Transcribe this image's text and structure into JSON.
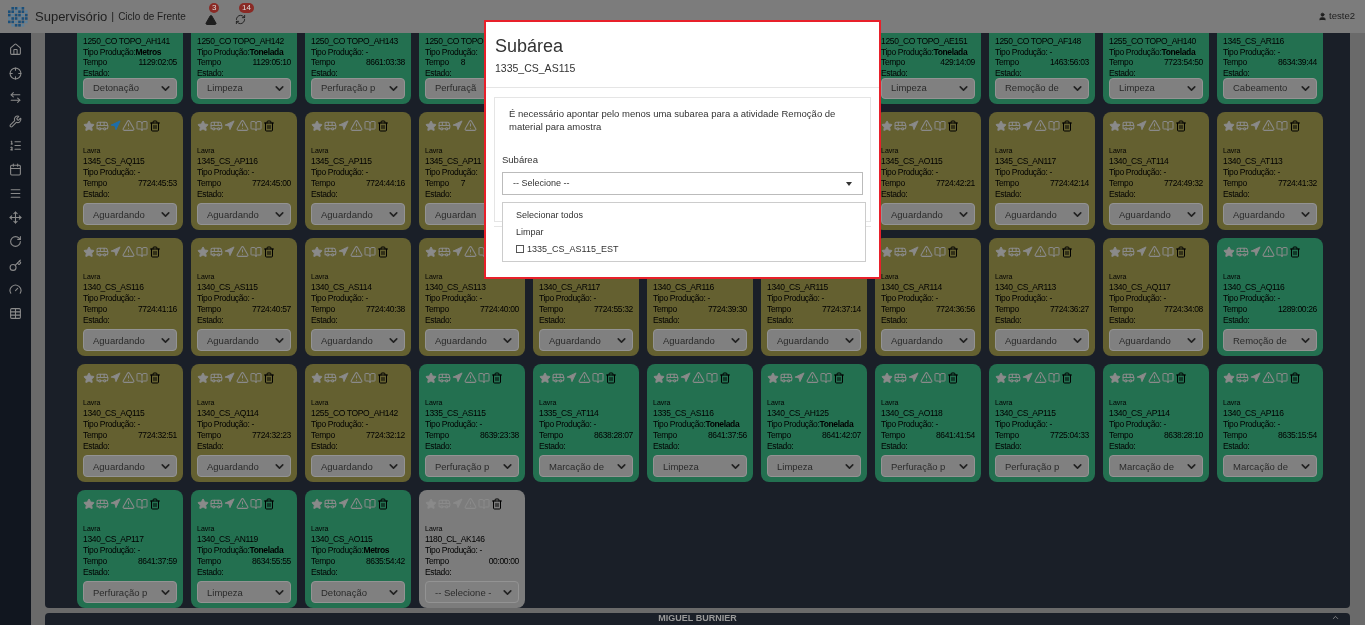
{
  "header": {
    "app": "Supervisório",
    "separator": "|",
    "module": "Ciclo de Frente",
    "alerts": [
      {
        "kind": "warning",
        "count": "3"
      },
      {
        "kind": "refresh",
        "count": "14"
      }
    ],
    "user": "teste2"
  },
  "rows": [
    [
      {
        "kind": "scrolled",
        "name": "1250_CO TOPO_AH141",
        "production": "Tipo Produção:**Metros**",
        "time_label": "Tempo",
        "time": "1129:02:05",
        "state_label": "Estado:",
        "state": "Detonação",
        "color": "#237050"
      },
      {
        "kind": "scrolled",
        "name": "1250_CO TOPO_AH142",
        "production": "Tipo Produção:**Tonelada**",
        "time_label": "Tempo",
        "time": "1129:05:10",
        "state_label": "Estado:",
        "state": "Limpeza",
        "color": "#237050"
      },
      {
        "kind": "scrolled",
        "name": "1250_CO TOPO_AH143",
        "production": "Tipo Produção: -",
        "time_label": "Tempo",
        "time": "8661:03:38",
        "state_label": "Estado:",
        "state": "Perfuração p",
        "color": "#237050"
      },
      {
        "kind": "scrolled_clipped",
        "name": "1250_CO TOPO",
        "production": "Tipo Produção:",
        "time_label": "Tempo",
        "time": "8",
        "state_label": "Estado:",
        "state": "Perfuraçã",
        "color": "#237050"
      },
      null,
      null,
      null,
      {
        "kind": "scrolled",
        "name": "1250_CO TOPO_AE151",
        "production": "Tipo Produção:**Tonelada**",
        "time_label": "Tempo",
        "time": "429:14:09",
        "state_label": "Estado:",
        "state": "Limpeza",
        "color": "#237050"
      },
      {
        "kind": "scrolled",
        "name": "1250_CO TOPO_AF148",
        "production": "Tipo Produção: -",
        "time_label": "Tempo",
        "time": "1463:56:03",
        "state_label": "Estado:",
        "state": "Remoção de",
        "color": "#237050"
      },
      {
        "kind": "scrolled",
        "name": "1255_CO TOPO_AH140",
        "production": "Tipo Produção:**Tonelada**",
        "time_label": "Tempo",
        "time": "7723:54:50",
        "state_label": "Estado:",
        "state": "Limpeza",
        "color": "#237050"
      },
      {
        "kind": "scrolled",
        "name": "1345_CS_AR116",
        "production": "Tipo Produção: -",
        "time_label": "Tempo",
        "time": "8634:39:44",
        "state_label": "Estado:",
        "state": "Cabeamento",
        "color": "#237050"
      }
    ],
    [
      {
        "kind": "full",
        "area": "Lavra",
        "name": "1345_CS_AQ115",
        "production": "Tipo Produção: -",
        "time_label": "Tempo",
        "time": "7724:45:53",
        "state_label": "Estado:",
        "state": "Aguardando",
        "color": "#646030",
        "located": true
      },
      {
        "kind": "full",
        "area": "Lavra",
        "name": "1345_CS_AP116",
        "production": "Tipo Produção: -",
        "time_label": "Tempo",
        "time": "7724:45:00",
        "state_label": "Estado:",
        "state": "Aguardando",
        "color": "#646030",
        "located": false
      },
      {
        "kind": "full",
        "area": "Lavra",
        "name": "1345_CS_AP115",
        "production": "Tipo Produção: -",
        "time_label": "Tempo",
        "time": "7724:44:16",
        "state_label": "Estado:",
        "state": "Aguardando",
        "color": "#646030",
        "located": false
      },
      {
        "kind": "clipped",
        "area": "Lavra",
        "name": "1345_CS_AP11",
        "production": "Tipo Produção:",
        "time_label": "Tempo",
        "time": "7",
        "state_label": "Estado:",
        "state": "Aguardan",
        "color": "#646030",
        "located": false
      },
      null,
      null,
      null,
      {
        "kind": "full",
        "area": "Lavra",
        "name": "1345_CS_AO115",
        "production": "Tipo Produção: -",
        "time_label": "Tempo",
        "time": "7724:42:21",
        "state_label": "Estado:",
        "state": "Aguardando",
        "color": "#646030",
        "located": false
      },
      {
        "kind": "full",
        "area": "Lavra",
        "name": "1345_CS_AN117",
        "production": "Tipo Produção: -",
        "time_label": "Tempo",
        "time": "7724:42:14",
        "state_label": "Estado:",
        "state": "Aguardando",
        "color": "#646030",
        "located": false
      },
      {
        "kind": "full",
        "area": "Lavra",
        "name": "1340_CS_AT114",
        "production": "Tipo Produção: -",
        "time_label": "Tempo",
        "time": "7724:49:32",
        "state_label": "Estado:",
        "state": "Aguardando",
        "color": "#646030",
        "located": false
      },
      {
        "kind": "full",
        "area": "Lavra",
        "name": "1340_CS_AT113",
        "production": "Tipo Produção: -",
        "time_label": "Tempo",
        "time": "7724:41:32",
        "state_label": "Estado:",
        "state": "Aguardando",
        "color": "#646030",
        "located": false
      }
    ],
    [
      {
        "kind": "full",
        "area": "Lavra",
        "name": "1340_CS_AS116",
        "production": "Tipo Produção: -",
        "time_label": "Tempo",
        "time": "7724:41:16",
        "state_label": "Estado:",
        "state": "Aguardando",
        "color": "#646030",
        "located": false
      },
      {
        "kind": "full",
        "area": "Lavra",
        "name": "1340_CS_AS115",
        "production": "Tipo Produção: -",
        "time_label": "Tempo",
        "time": "7724:40:57",
        "state_label": "Estado:",
        "state": "Aguardando",
        "color": "#646030",
        "located": false
      },
      {
        "kind": "full",
        "area": "Lavra",
        "name": "1340_CS_AS114",
        "production": "Tipo Produção: -",
        "time_label": "Tempo",
        "time": "7724:40:38",
        "state_label": "Estado:",
        "state": "Aguardando",
        "color": "#646030",
        "located": false
      },
      {
        "kind": "icons_clipped",
        "area": "Lavra",
        "name": "1340_CS_AS113",
        "production": "Tipo Produção: -",
        "time_label": "Tempo",
        "time": "7724:40:00",
        "state_label": "Estado:",
        "state": "Aguardando",
        "color": "#646030",
        "located": false
      },
      {
        "kind": "covered",
        "name": "1340_CS_AR117",
        "production": "Tipo Produção: -",
        "time_label": "Tempo",
        "time": "7724:55:32",
        "state_label": "Estado:",
        "state": "Aguardando",
        "color": "#646030"
      },
      {
        "kind": "covered",
        "name": "1340_CS_AR116",
        "production": "Tipo Produção: -",
        "time_label": "Tempo",
        "time": "7724:39:30",
        "state_label": "Estado:",
        "state": "Aguardando",
        "color": "#646030"
      },
      {
        "kind": "covered",
        "name": "1340_CS_AR115",
        "production": "Tipo Produção: -",
        "time_label": "Tempo",
        "time": "7724:37:14",
        "state_label": "Estado:",
        "state": "Aguardando",
        "color": "#646030"
      },
      {
        "kind": "full",
        "area": "Lavra",
        "name": "1340_CS_AR114",
        "production": "Tipo Produção: -",
        "time_label": "Tempo",
        "time": "7724:36:56",
        "state_label": "Estado:",
        "state": "Aguardando",
        "color": "#646030",
        "located": false
      },
      {
        "kind": "full",
        "area": "Lavra",
        "name": "1340_CS_AR113",
        "production": "Tipo Produção: -",
        "time_label": "Tempo",
        "time": "7724:36:27",
        "state_label": "Estado:",
        "state": "Aguardando",
        "color": "#646030",
        "located": false
      },
      {
        "kind": "full",
        "area": "Lavra",
        "name": "1340_CS_AQ117",
        "production": "Tipo Produção: -",
        "time_label": "Tempo",
        "time": "7724:34:08",
        "state_label": "Estado:",
        "state": "Aguardando",
        "color": "#646030",
        "located": false
      },
      {
        "kind": "full",
        "area": "Lavra",
        "name": "1340_CS_AQ116",
        "production": "Tipo Produção: -",
        "time_label": "Tempo",
        "time": "1289:00:26",
        "state_label": "Estado:",
        "state": "Remoção de",
        "color": "#237050",
        "located": false
      }
    ],
    [
      {
        "kind": "full",
        "area": "Lavra",
        "name": "1340_CS_AQ115",
        "production": "Tipo Produção: -",
        "time_label": "Tempo",
        "time": "7724:32:51",
        "state_label": "Estado:",
        "state": "Aguardando",
        "color": "#646030",
        "located": false
      },
      {
        "kind": "full",
        "area": "Lavra",
        "name": "1340_CS_AQ114",
        "production": "Tipo Produção: -",
        "time_label": "Tempo",
        "time": "7724:32:23",
        "state_label": "Estado:",
        "state": "Aguardando",
        "color": "#646030",
        "located": false
      },
      {
        "kind": "full",
        "area": "Lavra",
        "name": "1255_CO TOPO_AH142",
        "production": "Tipo Produção: -",
        "time_label": "Tempo",
        "time": "7724:32:12",
        "state_label": "Estado:",
        "state": "Aguardando",
        "color": "#646030",
        "located": false
      },
      {
        "kind": "full",
        "area": "Lavra",
        "name": "1335_CS_AS115",
        "production": "Tipo Produção: -",
        "time_label": "Tempo",
        "time": "8639:23:38",
        "state_label": "Estado:",
        "state": "Perfuração p",
        "color": "#237050",
        "located": false
      },
      {
        "kind": "full",
        "area": "Lavra",
        "name": "1335_CS_AT114",
        "production": "Tipo Produção: -",
        "time_label": "Tempo",
        "time": "8638:28:07",
        "state_label": "Estado:",
        "state": "Marcação de",
        "color": "#237050",
        "located": false
      },
      {
        "kind": "full",
        "area": "Lavra",
        "name": "1335_CS_AS116",
        "production": "Tipo Produção:**Tonelada**",
        "time_label": "Tempo",
        "time": "8641:37:56",
        "state_label": "Estado:",
        "state": "Limpeza",
        "color": "#237050",
        "located": false
      },
      {
        "kind": "full",
        "area": "Lavra",
        "name": "1340_CS_AH125",
        "production": "Tipo Produção:**Tonelada**",
        "time_label": "Tempo",
        "time": "8641:42:07",
        "state_label": "Estado:",
        "state": "Limpeza",
        "color": "#237050",
        "located": false
      },
      {
        "kind": "full",
        "area": "Lavra",
        "name": "1340_CS_AO118",
        "production": "Tipo Produção: -",
        "time_label": "Tempo",
        "time": "8641:41:54",
        "state_label": "Estado:",
        "state": "Perfuração p",
        "color": "#237050",
        "located": false
      },
      {
        "kind": "full",
        "area": "Lavra",
        "name": "1340_CS_AP115",
        "production": "Tipo Produção: -",
        "time_label": "Tempo",
        "time": "7725:04:33",
        "state_label": "Estado:",
        "state": "Perfuração p",
        "color": "#237050",
        "located": false
      },
      {
        "kind": "full",
        "area": "Lavra",
        "name": "1340_CS_AP114",
        "production": "Tipo Produção: -",
        "time_label": "Tempo",
        "time": "8638:28:10",
        "state_label": "Estado:",
        "state": "Marcação de",
        "color": "#237050",
        "located": false
      },
      {
        "kind": "full",
        "area": "Lavra",
        "name": "1340_CS_AP116",
        "production": "Tipo Produção: -",
        "time_label": "Tempo",
        "time": "8635:15:54",
        "state_label": "Estado:",
        "state": "Marcação de",
        "color": "#237050",
        "located": false
      }
    ],
    [
      {
        "kind": "full",
        "area": "Lavra",
        "name": "1340_CS_AP117",
        "production": "Tipo Produção: -",
        "time_label": "Tempo",
        "time": "8641:37:59",
        "state_label": "Estado:",
        "state": "Perfuração p",
        "color": "#237050",
        "located": false
      },
      {
        "kind": "full",
        "area": "Lavra",
        "name": "1340_CS_AN119",
        "production": "Tipo Produção:**Tonelada**",
        "time_label": "Tempo",
        "time": "8634:55:55",
        "state_label": "Estado:",
        "state": "Limpeza",
        "color": "#237050",
        "located": false
      },
      {
        "kind": "full",
        "area": "Lavra",
        "name": "1340_CS_AO115",
        "production": "Tipo Produção:**Metros**",
        "time_label": "Tempo",
        "time": "8635:54:42",
        "state_label": "Estado:",
        "state": "Detonação",
        "color": "#237050",
        "located": false
      },
      {
        "kind": "full",
        "area": "Lavra",
        "name": "1180_CL_AK146",
        "production": "Tipo Produção: -",
        "time_label": "Tempo",
        "time": "00:00:00",
        "state_label": "Estado:",
        "state": "-- Selecione -",
        "color": "#7c7c7c",
        "located": false
      }
    ]
  ],
  "next_section": {
    "title": "MIGUEL BURNIER"
  },
  "dialog": {
    "title": "Subárea",
    "subtitle": "1335_CS_AS115",
    "message": "É necessário apontar pelo menos uma subarea para a atividade Remoção de material para amostra",
    "field_label": "Subárea",
    "select_value": "-- Selecione --",
    "options": [
      {
        "kind": "action",
        "label": "Selecionar todos"
      },
      {
        "kind": "action",
        "label": "Limpar"
      },
      {
        "kind": "checkbox",
        "label": "1335_CS_AS115_EST",
        "checked": false
      }
    ]
  }
}
